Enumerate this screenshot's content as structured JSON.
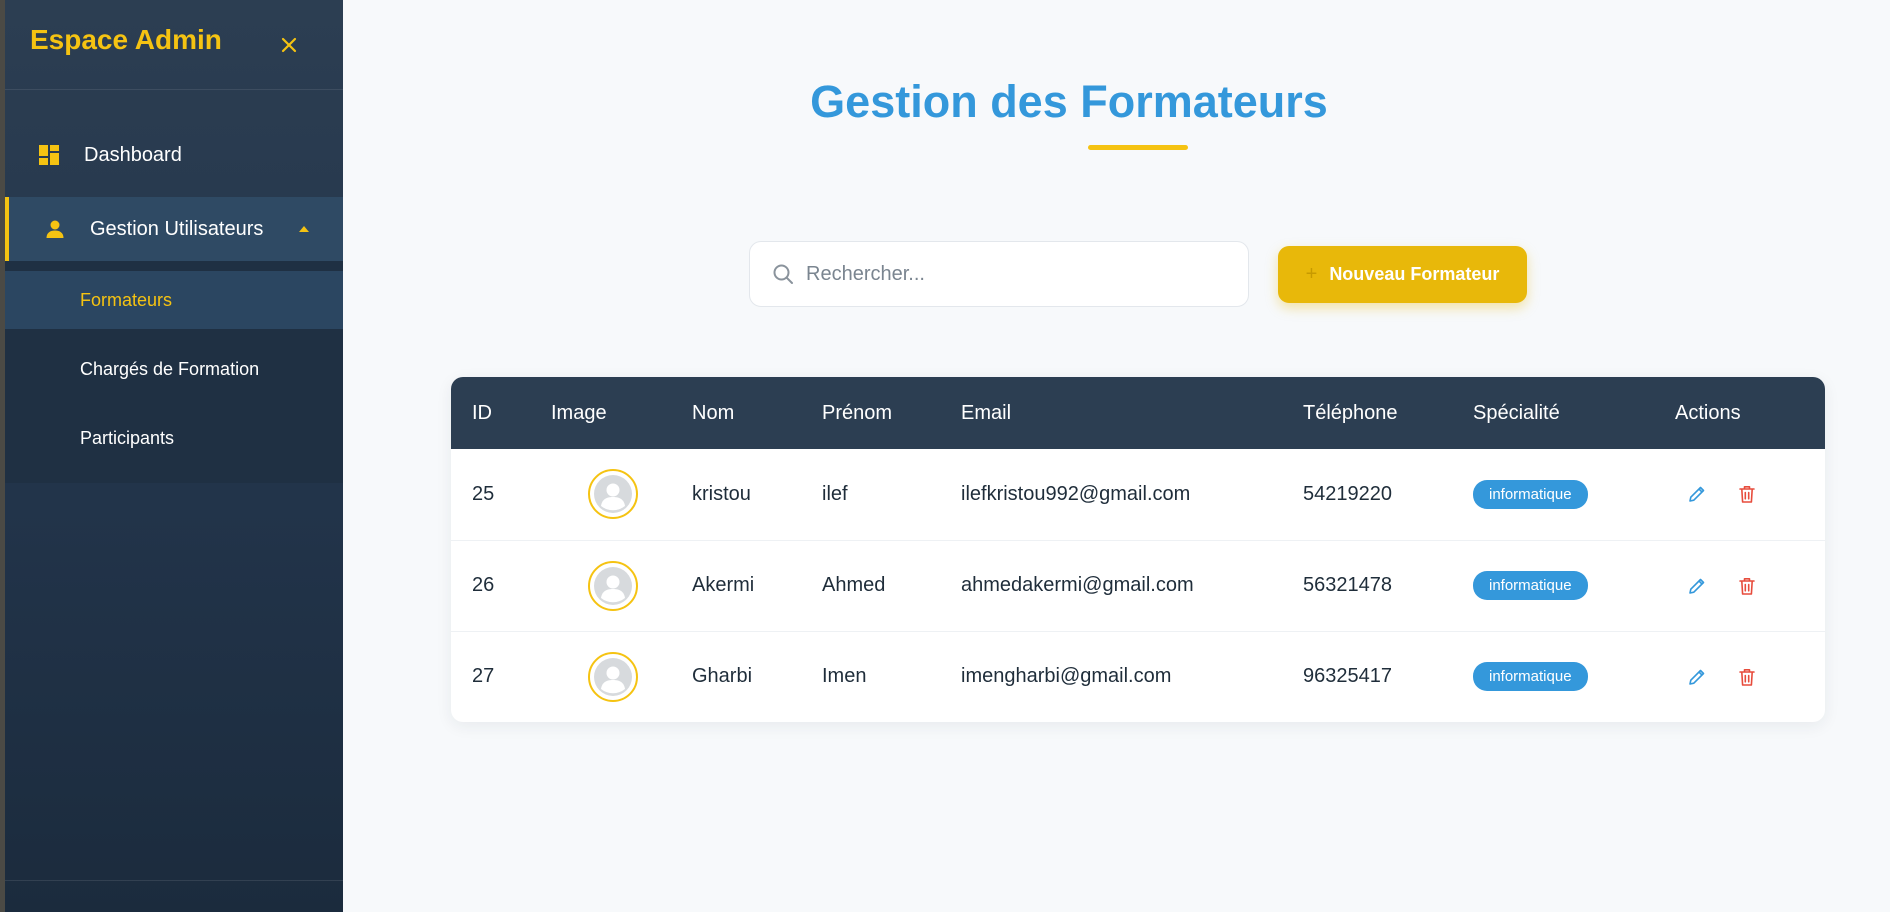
{
  "sidebar": {
    "brand": "Espace Admin",
    "close_icon": "close-icon",
    "items": [
      {
        "label": "Dashboard",
        "icon": "dashboard-icon"
      },
      {
        "label": "Gestion Utilisateurs",
        "icon": "user-icon",
        "expanded": true
      }
    ],
    "submenu": [
      {
        "label": "Formateurs",
        "active": true
      },
      {
        "label": "Chargés de Formation"
      },
      {
        "label": "Participants"
      }
    ]
  },
  "main": {
    "title": "Gestion des Formateurs",
    "search": {
      "placeholder": "Rechercher...",
      "value": ""
    },
    "add_button": "Nouveau Formateur"
  },
  "table": {
    "columns": [
      "ID",
      "Image",
      "Nom",
      "Prénom",
      "Email",
      "Téléphone",
      "Spécialité",
      "Actions"
    ],
    "rows": [
      {
        "id": "25",
        "nom": "kristou",
        "prenom": "ilef",
        "email": "ilefkristou992@gmail.com",
        "telephone": "54219220",
        "specialite": "informatique"
      },
      {
        "id": "26",
        "nom": "Akermi",
        "prenom": "Ahmed",
        "email": "ahmedakermi@gmail.com",
        "telephone": "56321478",
        "specialite": "informatique"
      },
      {
        "id": "27",
        "nom": "Gharbi",
        "prenom": "Imen",
        "email": "imengharbi@gmail.com",
        "telephone": "96325417",
        "specialite": "informatique"
      }
    ]
  },
  "colors": {
    "accent_yellow": "#f5c312",
    "title_blue": "#3498db",
    "sidebar_bg": "#2c3e52",
    "delete_red": "#e74c3c"
  }
}
